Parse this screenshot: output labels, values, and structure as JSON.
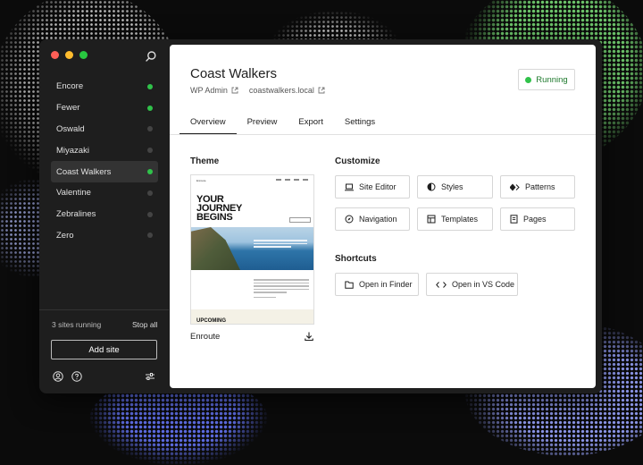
{
  "sidebar": {
    "sites": [
      {
        "name": "Encore",
        "running": true
      },
      {
        "name": "Fewer",
        "running": true
      },
      {
        "name": "Oswald",
        "running": false
      },
      {
        "name": "Miyazaki",
        "running": false
      },
      {
        "name": "Coast Walkers",
        "running": true
      },
      {
        "name": "Valentine",
        "running": false
      },
      {
        "name": "Zebralines",
        "running": false
      },
      {
        "name": "Zero",
        "running": false
      }
    ],
    "selected_index": 4,
    "running_count_label": "3 sites running",
    "stop_all_label": "Stop all",
    "add_site_label": "Add site"
  },
  "site": {
    "title": "Coast Walkers",
    "wp_admin_label": "WP Admin",
    "domain": "coastwalkers.local",
    "status_label": "Running"
  },
  "tabs": [
    {
      "label": "Overview",
      "active": true
    },
    {
      "label": "Preview",
      "active": false
    },
    {
      "label": "Export",
      "active": false
    },
    {
      "label": "Settings",
      "active": false
    }
  ],
  "theme": {
    "heading": "Theme",
    "name": "Enroute",
    "thumbnail_heading": "YOUR JOURNEY BEGINS",
    "thumbnail_footer": "UPCOMING",
    "thumbnail_brand": "Enroute"
  },
  "customize": {
    "heading": "Customize",
    "buttons": [
      "Site Editor",
      "Styles",
      "Patterns",
      "Navigation",
      "Templates",
      "Pages"
    ]
  },
  "shortcuts": {
    "heading": "Shortcuts",
    "buttons": [
      "Open in Finder",
      "Open in VS Code"
    ]
  },
  "colors": {
    "running_green": "#30c24a",
    "sidebar_bg": "#1e1e1e"
  }
}
